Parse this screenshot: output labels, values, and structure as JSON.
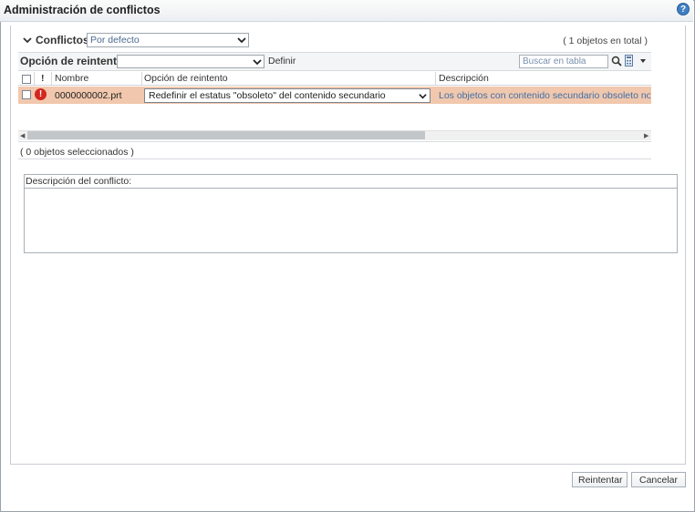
{
  "window": {
    "title": "Administración de conflictos",
    "help_glyph": "?"
  },
  "conflicts": {
    "section_title": "Conflictos",
    "view_selected": "Por defecto",
    "total_count": "( 1 objetos en total )"
  },
  "toolbar": {
    "retry_label": "Opción de reintento",
    "retry_value": "",
    "define_label": "Definir",
    "search_placeholder": "Buscar en tabla"
  },
  "table": {
    "columns": [
      "!",
      "Nombre",
      "Opción de reintento",
      "Descripción"
    ],
    "rows": [
      {
        "status": "error",
        "status_glyph": "!",
        "name": "0000000002.prt",
        "retry_option": "Redefinir el estatus \"obsoleto\" del contenido secundario",
        "description": "Los objetos con contenido secundario obsoleto no se p"
      }
    ]
  },
  "selection": {
    "count_text": "( 0 objetos seleccionados )"
  },
  "description_panel": {
    "label": "Descripción del conflicto:"
  },
  "buttons": {
    "retry": "Reintentar",
    "cancel": "Cancelar"
  },
  "colors": {
    "row_highlight": "#f1c8ad",
    "error_red": "#d3261d",
    "link_blue": "#3e6ea8",
    "help_blue": "#3f7fc3"
  },
  "icons": [
    "help-icon",
    "chevron-down-icon",
    "search-icon",
    "calculator-icon",
    "menu-arrow-icon",
    "error-icon"
  ]
}
